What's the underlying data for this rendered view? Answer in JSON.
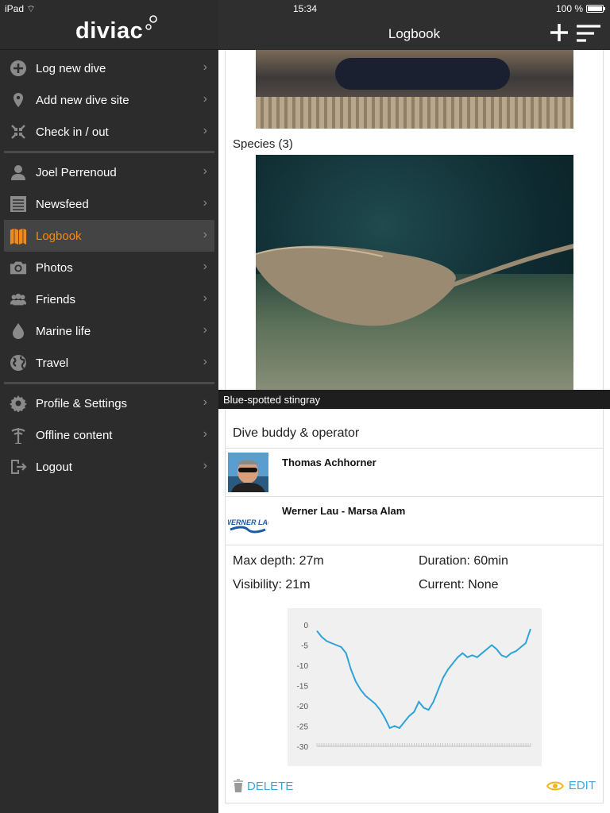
{
  "status": {
    "device": "iPad",
    "time": "15:34",
    "battery": "100 %"
  },
  "sidebar": {
    "logo": "diviac",
    "items": [
      {
        "label": "Log new dive",
        "icon": "plus-circle-icon"
      },
      {
        "label": "Add new dive site",
        "icon": "location-pin-icon"
      },
      {
        "label": "Check in / out",
        "icon": "arrows-collapse-icon"
      },
      {
        "label": "Joel Perrenoud",
        "icon": "user-icon"
      },
      {
        "label": "Newsfeed",
        "icon": "newsfeed-icon"
      },
      {
        "label": "Logbook",
        "icon": "logbook-icon",
        "active": true
      },
      {
        "label": "Photos",
        "icon": "camera-icon"
      },
      {
        "label": "Friends",
        "icon": "friends-icon"
      },
      {
        "label": "Marine life",
        "icon": "droplet-icon"
      },
      {
        "label": "Travel",
        "icon": "globe-icon"
      },
      {
        "label": "Profile & Settings",
        "icon": "gear-icon"
      },
      {
        "label": "Offline content",
        "icon": "offline-icon"
      },
      {
        "label": "Logout",
        "icon": "logout-icon"
      }
    ],
    "active_color": "#f08a1c"
  },
  "header": {
    "title": "Logbook",
    "add_icon": "plus-icon",
    "sort_icon": "sort-icon"
  },
  "main": {
    "species_label": "Species (3)",
    "species_caption": "Blue-spotted stingray",
    "buddy_section_title": "Dive buddy & operator",
    "buddies": [
      {
        "name": "Thomas Achhorner"
      },
      {
        "name": "Werner Lau - Marsa Alam",
        "logo_text": "WERNER LAU"
      }
    ],
    "stats": {
      "max_depth": "Max depth: 27m",
      "duration": "Duration: 60min",
      "visibility": "Visibility: 21m",
      "current": "Current: None"
    },
    "actions": {
      "delete": "DELETE",
      "edit": "EDIT"
    },
    "accent_color": "#3aa9d9"
  },
  "chart_data": {
    "type": "line",
    "title": "",
    "xlabel": "",
    "ylabel": "",
    "ylim": [
      -30,
      0
    ],
    "yticks": [
      0,
      -5,
      -10,
      -15,
      -20,
      -25,
      -30
    ],
    "grid": false,
    "series": [
      {
        "values": [
          -1.5,
          -3,
          -4,
          -4.5,
          -5,
          -5.5,
          -7,
          -11,
          -14,
          -16,
          -17.5,
          -18.5,
          -19.5,
          -21,
          -23,
          -25.5,
          -25,
          -25.5,
          -24,
          -22.5,
          -21.5,
          -19,
          -20.5,
          -21,
          -19,
          -16,
          -13,
          -11,
          -9.5,
          -8,
          -7,
          -8,
          -7.5,
          -8,
          -7,
          -6,
          -5,
          -6,
          -7.5,
          -8,
          -7,
          -6.5,
          -5.5,
          -4.5,
          -1
        ]
      }
    ],
    "line_color": "#2ea3d8"
  }
}
